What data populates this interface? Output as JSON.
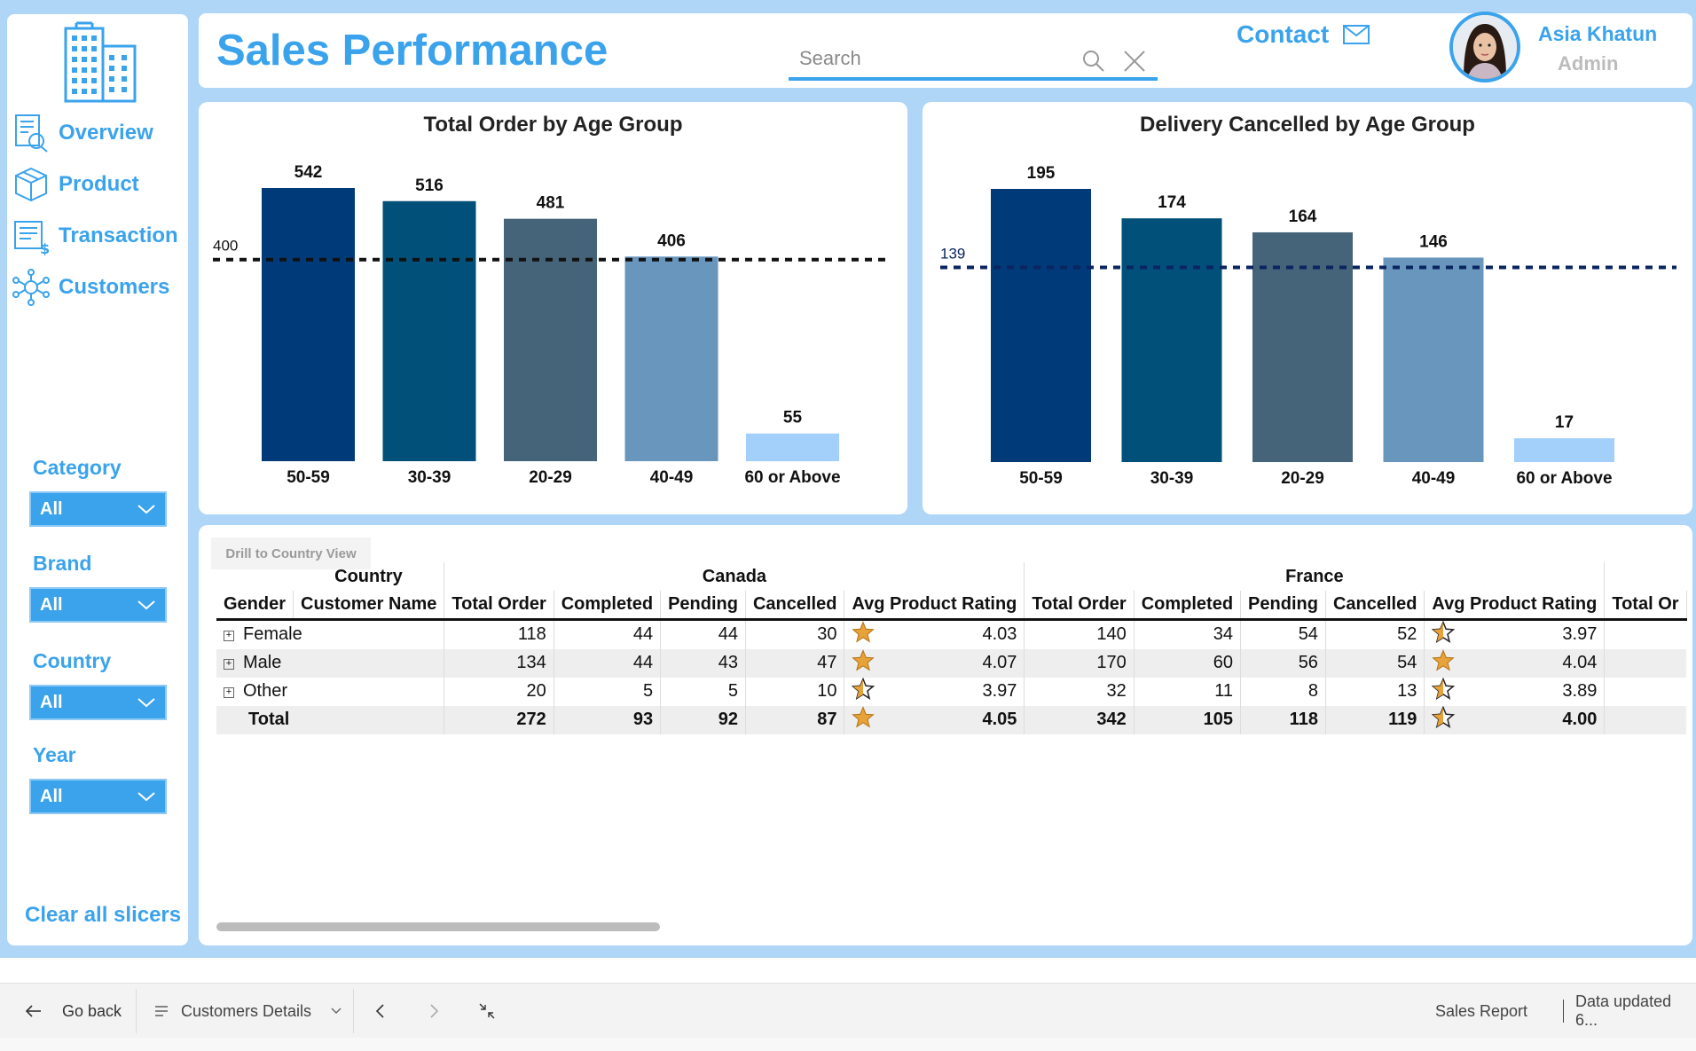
{
  "header": {
    "title": "Sales Performance",
    "search_placeholder": "Search",
    "contact_label": "Contact",
    "user_name": "Asia Khatun",
    "user_role": "Admin"
  },
  "sidebar": {
    "nav": [
      {
        "label": "Overview",
        "icon": "overview-report-icon"
      },
      {
        "label": "Product",
        "icon": "product-box-icon"
      },
      {
        "label": "Transaction",
        "icon": "transaction-list-icon"
      },
      {
        "label": "Customers",
        "icon": "customers-network-icon"
      }
    ],
    "slicers": [
      {
        "label": "Category",
        "value": "All"
      },
      {
        "label": "Brand",
        "value": "All"
      },
      {
        "label": "Country",
        "value": "All"
      },
      {
        "label": "Year",
        "value": "All"
      }
    ],
    "clear_label": "Clear all slicers"
  },
  "colors": {
    "accent": "#3aa3ec",
    "background": "#afd6f6",
    "bars": [
      "#003a78",
      "#00507a",
      "#456379",
      "#6896bd",
      "#a3d0fa"
    ],
    "star": "#e8a23a"
  },
  "chart_data": [
    {
      "type": "bar",
      "title": "Total Order by Age Group",
      "categories": [
        "50-59",
        "30-39",
        "20-29",
        "40-49",
        "60 or Above"
      ],
      "values": [
        542,
        516,
        481,
        406,
        55
      ],
      "reference_line": {
        "value": 400,
        "label": "400",
        "style": "dashed",
        "color": "#111111"
      },
      "data_labels": true
    },
    {
      "type": "bar",
      "title": "Delivery Cancelled by Age Group",
      "categories": [
        "50-59",
        "30-39",
        "20-29",
        "40-49",
        "60 or Above"
      ],
      "values": [
        195,
        174,
        164,
        146,
        17
      ],
      "reference_line": {
        "value": 139,
        "label": "139",
        "style": "dashed",
        "color": "#0a2560"
      },
      "data_labels": true
    }
  ],
  "matrix": {
    "drill_label": "Drill to Country View",
    "country_header": "Country",
    "countries": [
      "Canada",
      "France"
    ],
    "row_headers": [
      "Gender",
      "Customer Name"
    ],
    "measures": [
      "Total Order",
      "Completed",
      "Pending",
      "Cancelled",
      "Avg Product Rating"
    ],
    "extra_col": "Total Or",
    "rows": [
      {
        "label": "Female",
        "canada": [
          118,
          44,
          44,
          30
        ],
        "canada_rating": "4.03",
        "canada_star": "full",
        "france": [
          140,
          34,
          54,
          52
        ],
        "france_rating": "3.97",
        "france_star": "half"
      },
      {
        "label": "Male",
        "canada": [
          134,
          44,
          43,
          47
        ],
        "canada_rating": "4.07",
        "canada_star": "full",
        "france": [
          170,
          60,
          56,
          54
        ],
        "france_rating": "4.04",
        "france_star": "full"
      },
      {
        "label": "Other",
        "canada": [
          20,
          5,
          5,
          10
        ],
        "canada_rating": "3.97",
        "canada_star": "half",
        "france": [
          32,
          11,
          8,
          13
        ],
        "france_rating": "3.89",
        "france_star": "half"
      },
      {
        "label": "Total",
        "canada": [
          272,
          93,
          92,
          87
        ],
        "canada_rating": "4.05",
        "canada_star": "full",
        "france": [
          342,
          105,
          118,
          119
        ],
        "france_rating": "4.00",
        "france_star": "half"
      }
    ]
  },
  "bottombar": {
    "go_back": "Go back",
    "page_name": "Customers Details",
    "report_name": "Sales Report",
    "data_updated": "Data updated 6..."
  }
}
